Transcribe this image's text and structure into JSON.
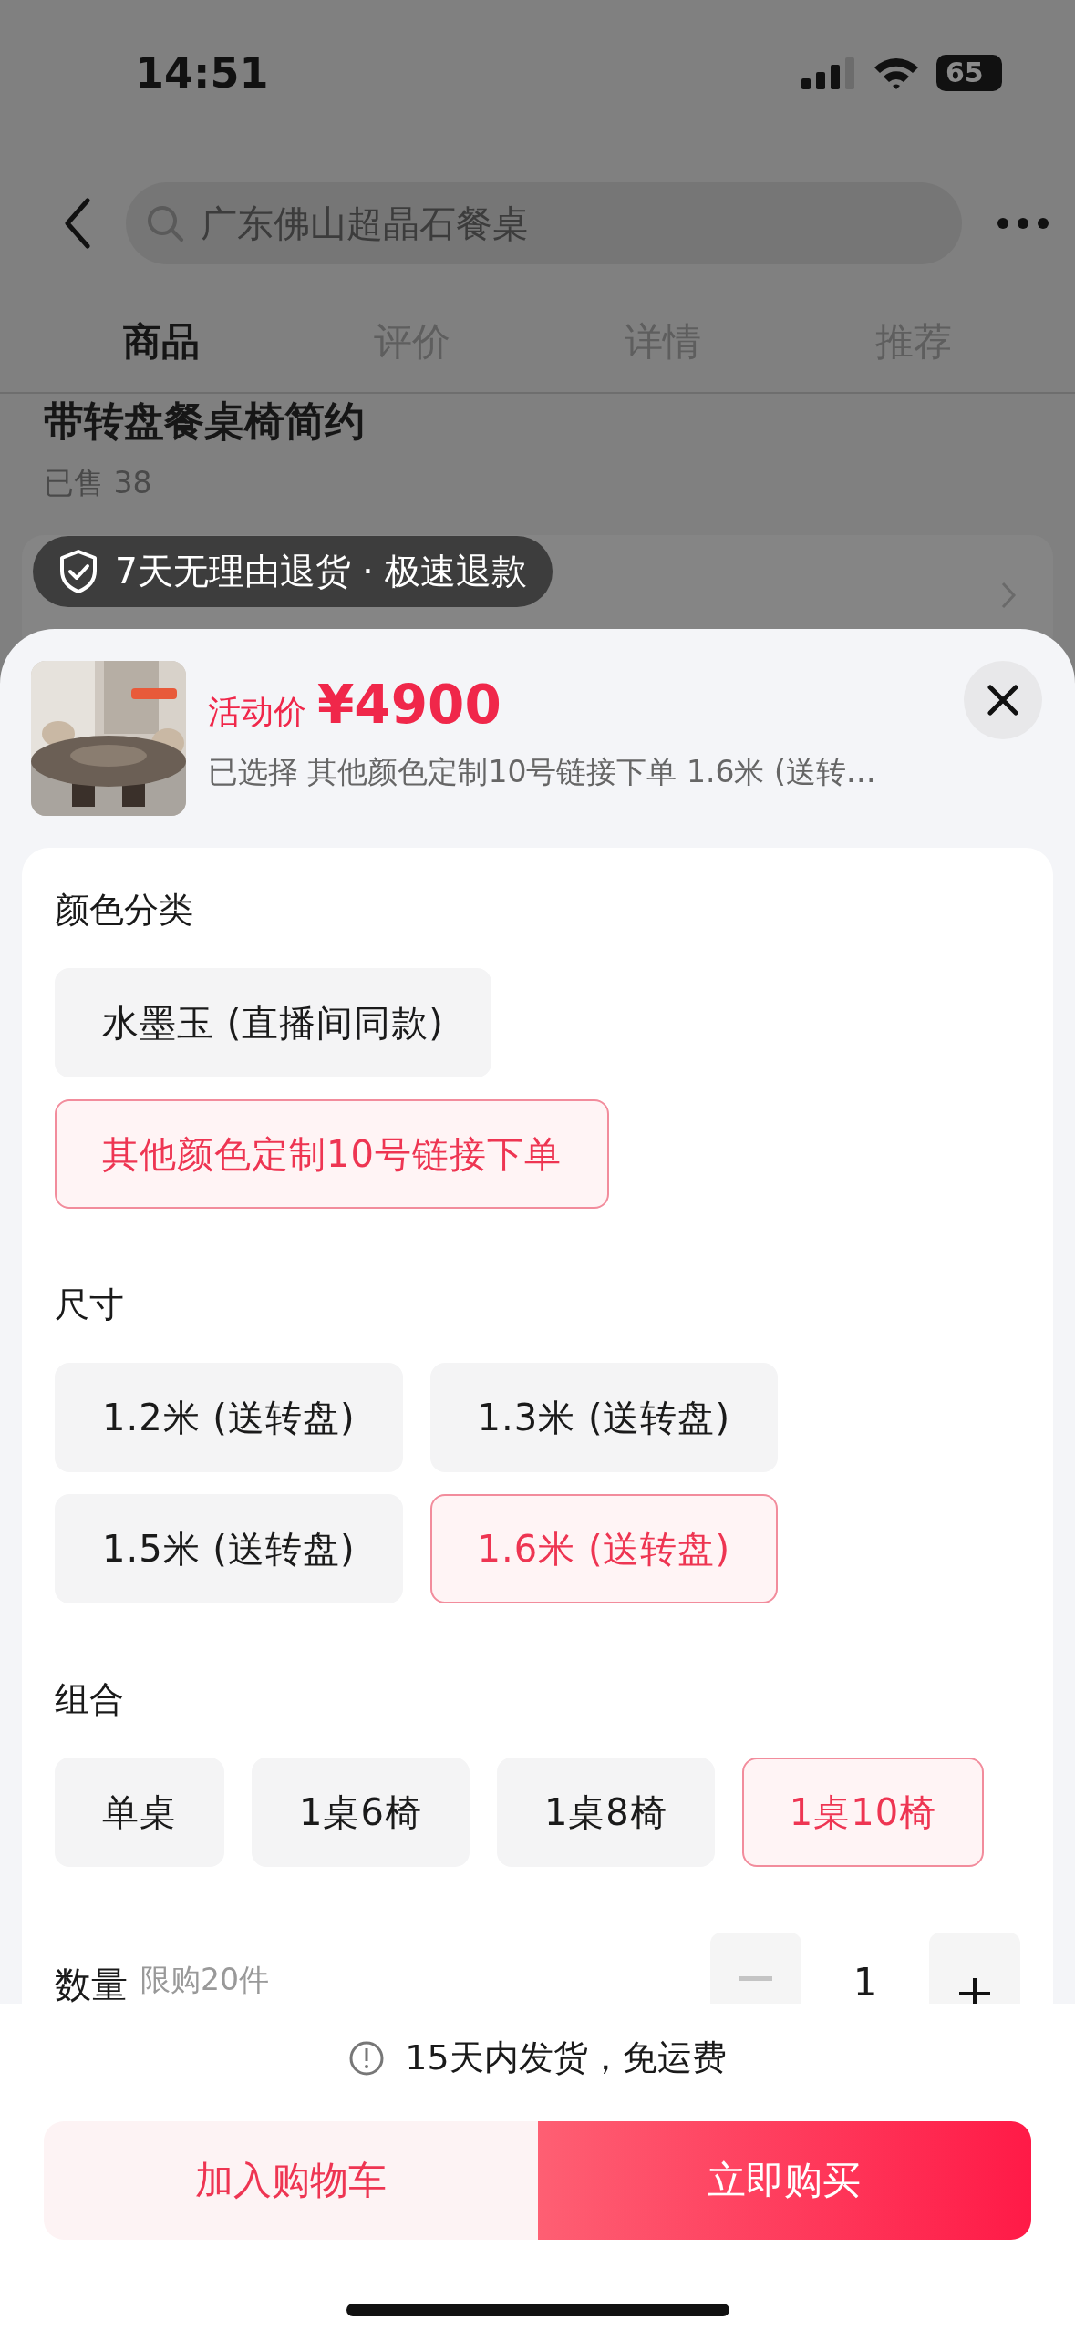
{
  "status_bar": {
    "time": "14:51",
    "battery": "65"
  },
  "search": {
    "value": "广东佛山超晶石餐桌"
  },
  "tabs": [
    {
      "label": "商品",
      "selected": true
    },
    {
      "label": "评价",
      "selected": false
    },
    {
      "label": "详情",
      "selected": false
    },
    {
      "label": "推荐",
      "selected": false
    }
  ],
  "product": {
    "title": "带转盘餐桌椅简约",
    "sold": "已售 38"
  },
  "toast": {
    "text": "7天无理由退货 · 极速退款"
  },
  "sheet": {
    "price_label": "活动价",
    "price": "¥4900",
    "selected_summary": "已选择 其他颜色定制10号链接下单 1.6米 (送转…",
    "groups": [
      {
        "title": "颜色分类",
        "options": [
          {
            "label": "水墨玉 (直播间同款)",
            "selected": false
          },
          {
            "label": "其他颜色定制10号链接下单",
            "selected": true
          }
        ]
      },
      {
        "title": "尺寸",
        "options": [
          {
            "label": "1.2米 (送转盘)",
            "selected": false
          },
          {
            "label": "1.3米 (送转盘)",
            "selected": false
          },
          {
            "label": "1.5米 (送转盘)",
            "selected": false
          },
          {
            "label": "1.6米 (送转盘)",
            "selected": true
          }
        ]
      },
      {
        "title": "组合",
        "options": [
          {
            "label": "单桌",
            "selected": false
          },
          {
            "label": "1桌6椅",
            "selected": false
          },
          {
            "label": "1桌8椅",
            "selected": false
          },
          {
            "label": "1桌10椅",
            "selected": true
          }
        ]
      }
    ],
    "quantity": {
      "label": "数量",
      "limit": "限购20件",
      "value": "1",
      "minus_disabled": true
    },
    "notice": "15天内发货，免运费",
    "buttons": [
      {
        "label": "加入购物车",
        "kind": "secondary"
      },
      {
        "label": "立即购买",
        "kind": "primary"
      }
    ]
  }
}
